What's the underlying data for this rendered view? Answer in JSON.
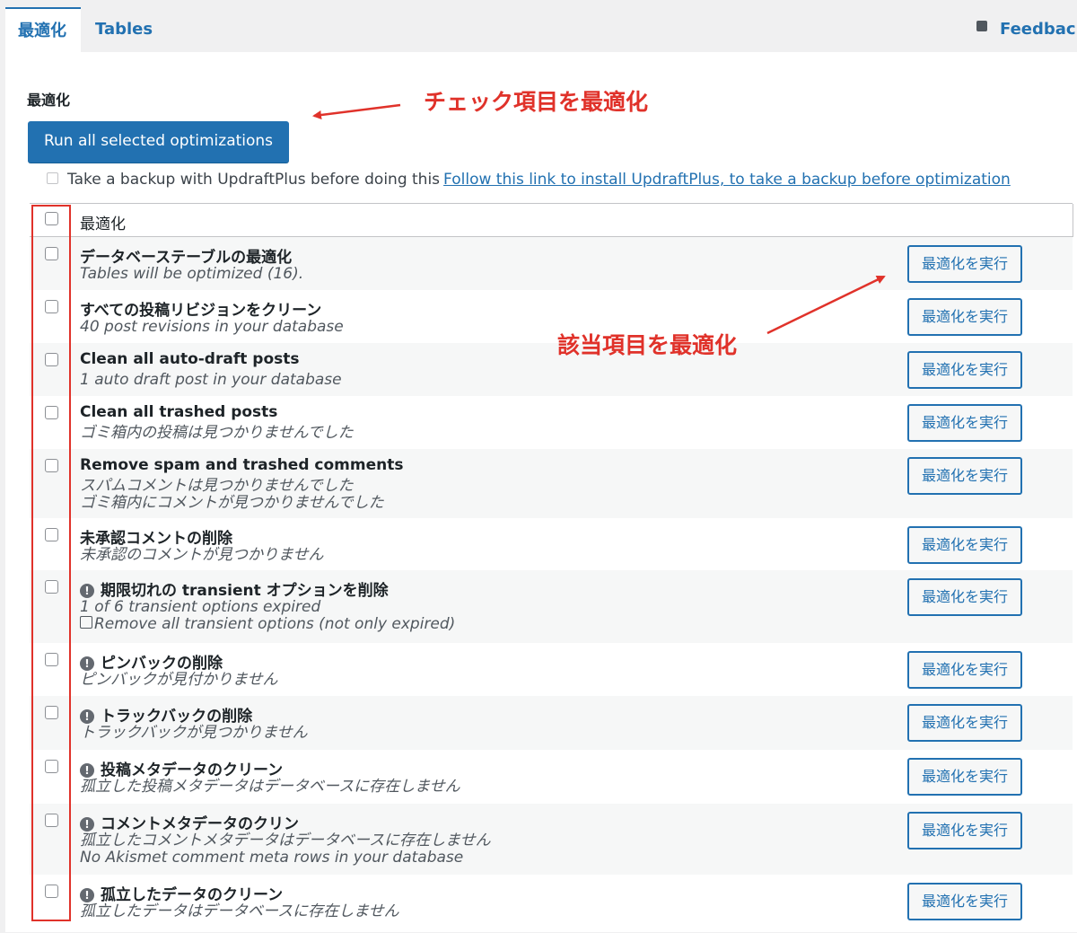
{
  "tabs": [
    {
      "label": "最適化",
      "active": true
    },
    {
      "label": "Tables",
      "active": false
    }
  ],
  "feedback": {
    "label": "Feedback",
    "icon": "comment-icon"
  },
  "section": {
    "heading": "最適化",
    "run_all_button": "Run all selected optimizations",
    "backup": {
      "label": "Take a backup with UpdraftPlus before doing this",
      "link": "Follow this link to install UpdraftPlus, to take a backup before optimization"
    }
  },
  "table": {
    "header_label": "最適化",
    "action_label": "最適化を実行",
    "rows": [
      {
        "title": "データベーステーブルの最適化",
        "desc": [
          "Tables will be optimized (16)."
        ],
        "warning": false
      },
      {
        "title": "すべての投稿リビジョンをクリーン",
        "desc": [
          "40 post revisions in your database"
        ],
        "warning": false
      },
      {
        "title": "Clean all auto-draft posts",
        "desc": [
          "1 auto draft post in your database"
        ],
        "warning": false
      },
      {
        "title": "Clean all trashed posts",
        "desc": [
          "ゴミ箱内の投稿は見つかりませんでした"
        ],
        "warning": false
      },
      {
        "title": "Remove spam and trashed comments",
        "desc": [
          "スパムコメントは見つかりませんでした",
          "ゴミ箱内にコメントが見つかりませんでした"
        ],
        "warning": false
      },
      {
        "title": "未承認コメントの削除",
        "desc": [
          "未承認のコメントが見つかりません"
        ],
        "warning": false
      },
      {
        "title": "期限切れの transient オプションを削除",
        "desc": [
          "1 of 6 transient options expired",
          "Remove all transient options (not only expired)"
        ],
        "warning": true,
        "inline_checkbox_on_line": 1
      },
      {
        "title": "ピンバックの削除",
        "desc": [
          "ピンバックが見付かりません"
        ],
        "warning": true
      },
      {
        "title": "トラックバックの削除",
        "desc": [
          "トラックバックが見つかりません"
        ],
        "warning": true
      },
      {
        "title": "投稿メタデータのクリーン",
        "desc": [
          "孤立した投稿メタデータはデータベースに存在しません"
        ],
        "warning": true
      },
      {
        "title": "コメントメタデータのクリン",
        "desc": [
          "孤立したコメントメタデータはデータベースに存在しません",
          "No Akismet comment meta rows in your database"
        ],
        "warning": true
      },
      {
        "title": "孤立したデータのクリーン",
        "desc": [
          "孤立したデータはデータベースに存在しません"
        ],
        "warning": true
      }
    ]
  },
  "annotations": {
    "top": "チェック項目を最適化",
    "middle": "該当項目を最適化",
    "color": "#e0322a"
  },
  "colors": {
    "accent": "#2271b1",
    "annotation": "#e0322a"
  }
}
